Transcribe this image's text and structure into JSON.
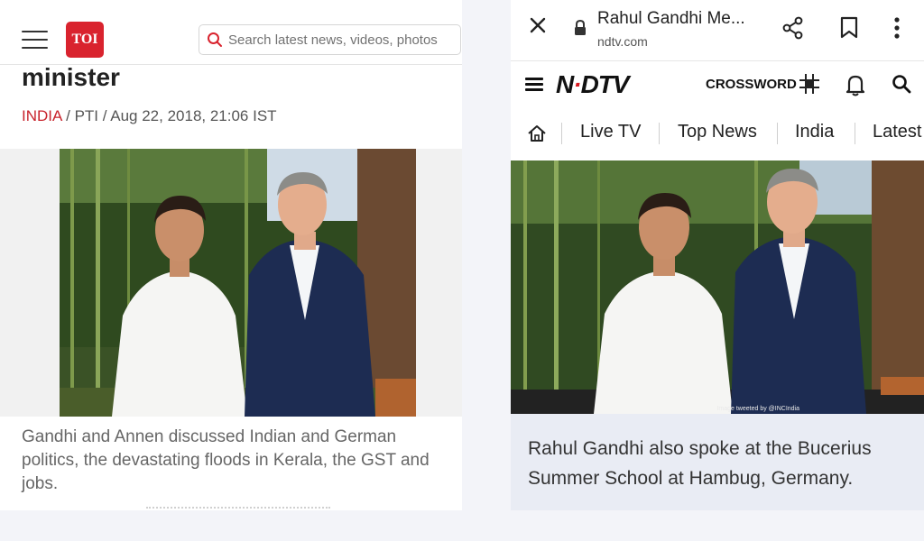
{
  "toi": {
    "logo_text": "TOI",
    "search_placeholder": "Search latest news, videos, photos",
    "headline_fragment": "minister",
    "byline": {
      "section": "INDIA",
      "source": " / PTI / Aug 22, 2018, 21:06 IST"
    },
    "caption": "Gandhi and Annen discussed Indian and German politics, the devastating floods in Kerala, the GST and jobs."
  },
  "browser": {
    "page_title": "Rahul Gandhi Me...",
    "url": "ndtv.com"
  },
  "ndtv": {
    "logo_part1": "N",
    "logo_dot": "·",
    "logo_part2": "DTV",
    "crossword_label": "CROSSWORD",
    "nav": [
      "Live TV",
      "Top News",
      "India",
      "Latest"
    ],
    "image_credit": "Image tweeted by @INCIndia",
    "caption": "Rahul Gandhi also spoke at the Bucerius Summer School at Hambug, Germany."
  },
  "colors": {
    "toi_red": "#d9232e",
    "ndtv_red": "#d71920",
    "caption_bg": "#e9ecf4"
  },
  "icons": [
    "hamburger-icon",
    "search-icon",
    "close-icon",
    "lock-icon",
    "share-icon",
    "bookmark-icon",
    "more-vertical-icon",
    "crossword-grid-icon",
    "bell-icon",
    "home-icon"
  ]
}
